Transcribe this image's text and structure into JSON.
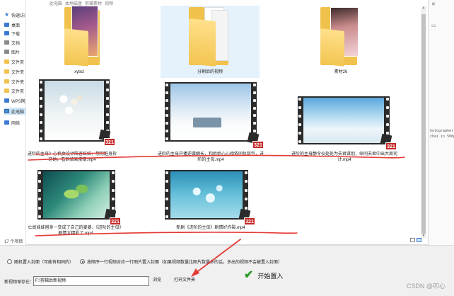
{
  "breadcrumb": [
    "此电脑",
    "本地磁盘",
    "剪辑素材",
    "视频"
  ],
  "nav": {
    "items": [
      {
        "label": "快速访问",
        "icon": "star-icon"
      },
      {
        "label": "桌面",
        "icon": "desktop-icon"
      },
      {
        "label": "下载",
        "icon": "download-icon"
      },
      {
        "label": "文档",
        "icon": "document-icon"
      },
      {
        "label": "图片",
        "icon": "picture-icon"
      },
      {
        "label": "文件夹",
        "icon": "folder-icon"
      },
      {
        "label": "文件夹",
        "icon": "folder-icon"
      },
      {
        "label": "文件夹",
        "icon": "folder-icon"
      },
      {
        "label": "文件夹",
        "icon": "folder-icon"
      },
      {
        "label": "WPS网盘",
        "icon": "cloud-icon"
      },
      {
        "label": "此电脑",
        "icon": "pc-icon"
      },
      {
        "label": "网络",
        "icon": "network-icon"
      }
    ]
  },
  "files": [
    {
      "name": "xybcl",
      "type": "folder"
    },
    {
      "name": "分割后的视频",
      "type": "folder"
    },
    {
      "name": "素材26",
      "type": "folder"
    },
    {
      "name": "进阶的主母》心机女设计陷害妹妹，想用脏身拆穿她，看到结果傻眼.mp4",
      "type": "video"
    },
    {
      "name": "进阶的主母开播逆袭嫡长，和姐姐心心相依同仇敌忾，进阶的主母.mp4",
      "type": "video"
    },
    {
      "name": "进阶的主母静令仪处处为夫君谋划，命同夫君中出大周司计.mp4",
      "type": "video"
    },
    {
      "name": "亡故妹妹留身一变成了自己的婆婆，《进阶的主母》剧情太精彩了.mp4",
      "type": "video"
    },
    {
      "name": "新剧《进阶的主母》剧情好炸裂.mp4",
      "type": "video"
    }
  ],
  "badge_text": "321",
  "status": {
    "count": "17 个项目"
  },
  "right_strip": {
    "lines": [
      "hotographer",
      "chai in 500p"
    ]
  },
  "app": {
    "radio_random": "随机置入封面（可能有相同的）",
    "radio_sequential": "按顺序一行视频对应一行图片置入封面（如果视频数量比图片数量多的话，多出的视频不会被置入封面）",
    "save_label": "新视频保存在：",
    "save_path": "F:\\剪辑后新视频",
    "browse": "浏览",
    "open_folder": "打开文件夹",
    "start": "开始置入"
  },
  "watermark": "CSDN @叩心",
  "colors": {
    "annotation": "#e53935",
    "accent": "#3b79d4",
    "folder": "#f0c24c",
    "badge": "#c62828"
  }
}
